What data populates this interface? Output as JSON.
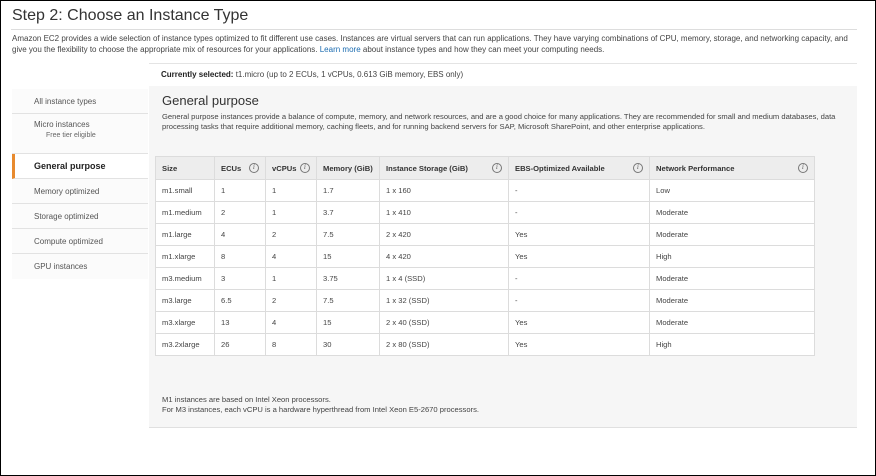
{
  "page": {
    "title": "Step 2: Choose an Instance Type",
    "intro_text": "Amazon EC2 provides a wide selection of instance types optimized to fit different use cases. Instances are virtual servers that can run applications. They have varying combinations of CPU, memory, storage, and networking capacity, and give you the flexibility to choose the appropriate mix of resources for your applications.",
    "learn_more": "Learn more",
    "intro_suffix": "about instance types and how they can meet your computing needs."
  },
  "selection": {
    "label": "Currently selected:",
    "value": "t1.micro (up to 2 ECUs, 1 vCPUs, 0.613 GiB memory, EBS only)"
  },
  "sidebar": {
    "items": [
      {
        "label": "All instance types"
      },
      {
        "label": "Micro instances",
        "sub": "Free tier eligible"
      },
      {
        "label": "General purpose"
      },
      {
        "label": "Memory optimized"
      },
      {
        "label": "Storage optimized"
      },
      {
        "label": "Compute optimized"
      },
      {
        "label": "GPU instances"
      }
    ]
  },
  "section": {
    "heading": "General purpose",
    "description": "General purpose instances provide a balance of compute, memory, and network resources, and are a good choice for many applications. They are recommended for small and medium databases, data processing tasks that require additional memory, caching fleets, and for running backend servers for SAP, Microsoft SharePoint, and other enterprise applications."
  },
  "table": {
    "columns": [
      "Size",
      "ECUs",
      "vCPUs",
      "Memory (GiB)",
      "Instance Storage (GiB)",
      "EBS-Optimized Available",
      "Network Performance"
    ],
    "info_icon": "i",
    "rows": [
      [
        "m1.small",
        "1",
        "1",
        "1.7",
        "1 x 160",
        "-",
        "Low"
      ],
      [
        "m1.medium",
        "2",
        "1",
        "3.7",
        "1 x 410",
        "-",
        "Moderate"
      ],
      [
        "m1.large",
        "4",
        "2",
        "7.5",
        "2 x 420",
        "Yes",
        "Moderate"
      ],
      [
        "m1.xlarge",
        "8",
        "4",
        "15",
        "4 x 420",
        "Yes",
        "High"
      ],
      [
        "m3.medium",
        "3",
        "1",
        "3.75",
        "1 x 4 (SSD)",
        "-",
        "Moderate"
      ],
      [
        "m3.large",
        "6.5",
        "2",
        "7.5",
        "1 x 32 (SSD)",
        "-",
        "Moderate"
      ],
      [
        "m3.xlarge",
        "13",
        "4",
        "15",
        "2 x 40 (SSD)",
        "Yes",
        "Moderate"
      ],
      [
        "m3.2xlarge",
        "26",
        "8",
        "30",
        "2 x 80 (SSD)",
        "Yes",
        "High"
      ]
    ]
  },
  "footnotes": {
    "line1": "M1 instances are based on Intel Xeon processors.",
    "line2": "For M3 instances, each vCPU is a hardware hyperthread from Intel Xeon E5-2670 processors."
  },
  "colors": {
    "accent": "#e88a2e",
    "link": "#1a6bb0",
    "header_bg": "#ededed"
  }
}
